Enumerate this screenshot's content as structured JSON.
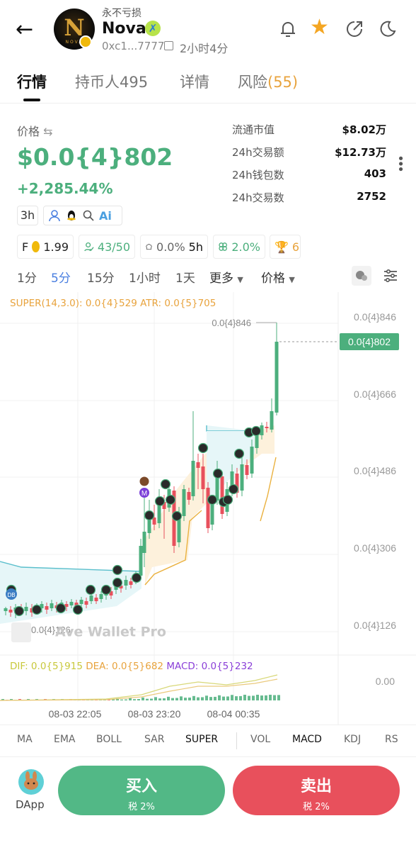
{
  "header": {
    "slogan": "永不亏损",
    "token_name": "Nova",
    "address": "0xc1...7777",
    "age": "2小时4分",
    "logo_text": "NOVA",
    "logo_letter": "N"
  },
  "tabs": [
    {
      "label": "行情"
    },
    {
      "label": "持币人495"
    },
    {
      "label": "详情"
    },
    {
      "label": "风险",
      "count": "(55)"
    }
  ],
  "price": {
    "label": "价格",
    "value": "$0.0{4}802",
    "change": "+2,285.44%",
    "age_chip": "3h"
  },
  "stats": [
    {
      "label": "流通市值",
      "value": "$8.02万"
    },
    {
      "label": "24h交易额",
      "value": "$12.73万"
    },
    {
      "label": "24h钱包数",
      "value": "403"
    },
    {
      "label": "24h交易数",
      "value": "2752"
    }
  ],
  "chips": {
    "f_label": "F",
    "f_value": "1.99",
    "holders": "43/50",
    "chef": "0.0%",
    "chef_time": "5h",
    "bundle": "2.0%",
    "trophy": "6"
  },
  "intervals": [
    "1分",
    "5分",
    "15分",
    "1小时",
    "1天",
    "更多",
    "价格"
  ],
  "chart": {
    "super_label": "SUPER(14,3.0): 0.0{4}529 ATR: 0.0{5}705",
    "macd_dif": "DIF: 0.0{5}915",
    "macd_dea": "DEA: 0.0{5}682",
    "macd_val": "MACD: 0.0{5}232",
    "y_ticks": [
      "0.0{4}846",
      "0.0{4}666",
      "0.0{4}486",
      "0.0{4}306",
      "0.0{4}126"
    ],
    "macd_tick": "0.00",
    "high_label": "0.0{4}846",
    "low_label": "0.0{4}126",
    "last_price": "0.0{4}802",
    "x_ticks": [
      "08-03 22:05",
      "08-03 23:20",
      "08-04 00:35"
    ],
    "watermark": "Ave Wallet Pro",
    "badge_db": "DB",
    "badge_m": "M",
    "up_color": "#4caf7d",
    "down_color": "#e8505c"
  },
  "indicators": [
    "MA",
    "EMA",
    "BOLL",
    "SAR",
    "SUPER",
    "VOL",
    "MACD",
    "KDJ",
    "RS"
  ],
  "bottom": {
    "dapp": "DApp",
    "buy": "买入",
    "buy_tax": "税 2%",
    "sell": "卖出",
    "sell_tax": "税 2%"
  }
}
